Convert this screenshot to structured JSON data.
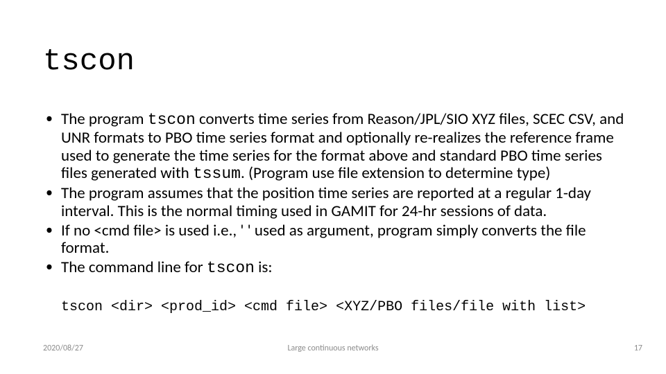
{
  "title": "tscon",
  "bullets": {
    "b1_pre": "The program ",
    "b1_code1": "tscon",
    "b1_mid": " converts time series from Reason/JPL/SIO XYZ files, SCEC CSV, and UNR formats to PBO time series format and optionally re-realizes the reference frame used to generate the time series for the format above and standard PBO time series files generated with ",
    "b1_code2": "tssum",
    "b1_post": ". (Program use file extension to determine type)",
    "b2": "The program assumes that the position time series are reported at a regular 1-day interval. This is the normal timing used in GAMIT for 24-hr sessions of data.",
    "b3": "If no <cmd file> is used i.e., ' ' used as argument, program simply converts the file format.",
    "b4_pre": "The command line for ",
    "b4_code": "tscon",
    "b4_post": " is:"
  },
  "cmdline": "tscon <dir> <prod_id> <cmd file> <XYZ/PBO files/file with list>",
  "footer": {
    "date": "2020/08/27",
    "center": "Large continuous networks",
    "page": "17"
  }
}
